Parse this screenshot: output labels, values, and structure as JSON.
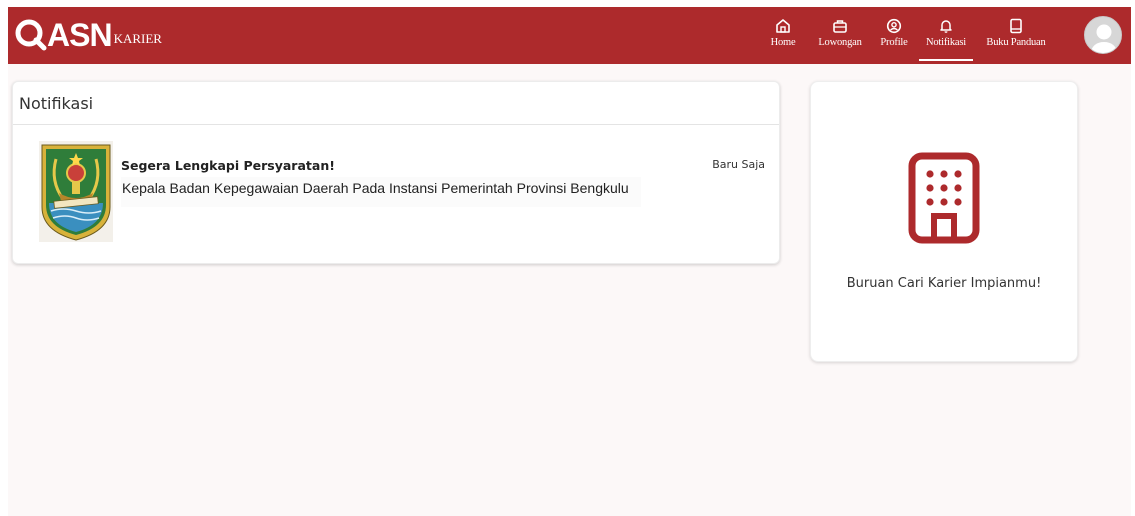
{
  "brand": {
    "name": "ASN",
    "sub": "KARIER",
    "color": "#ad2a2c"
  },
  "nav": {
    "items": [
      {
        "label": "Home",
        "icon": "home-icon"
      },
      {
        "label": "Lowongan",
        "icon": "briefcase-icon"
      },
      {
        "label": "Profile",
        "icon": "user-circle-icon"
      },
      {
        "label": "Notifikasi",
        "icon": "bell-icon",
        "active": true
      },
      {
        "label": "Buku Panduan",
        "icon": "book-icon"
      }
    ]
  },
  "main": {
    "title": "Notifikasi",
    "notifications": [
      {
        "title": "Segera Lengkapi Persyaratan!",
        "body": "Kepala Badan Kepegawaian Daerah Pada Instansi Pemerintah Provinsi Bengkulu",
        "time": "Baru Saja",
        "image": "bengkulu-emblem"
      }
    ]
  },
  "side": {
    "text": "Buruan Cari Karier Impianmu!",
    "icon": "building-icon"
  }
}
